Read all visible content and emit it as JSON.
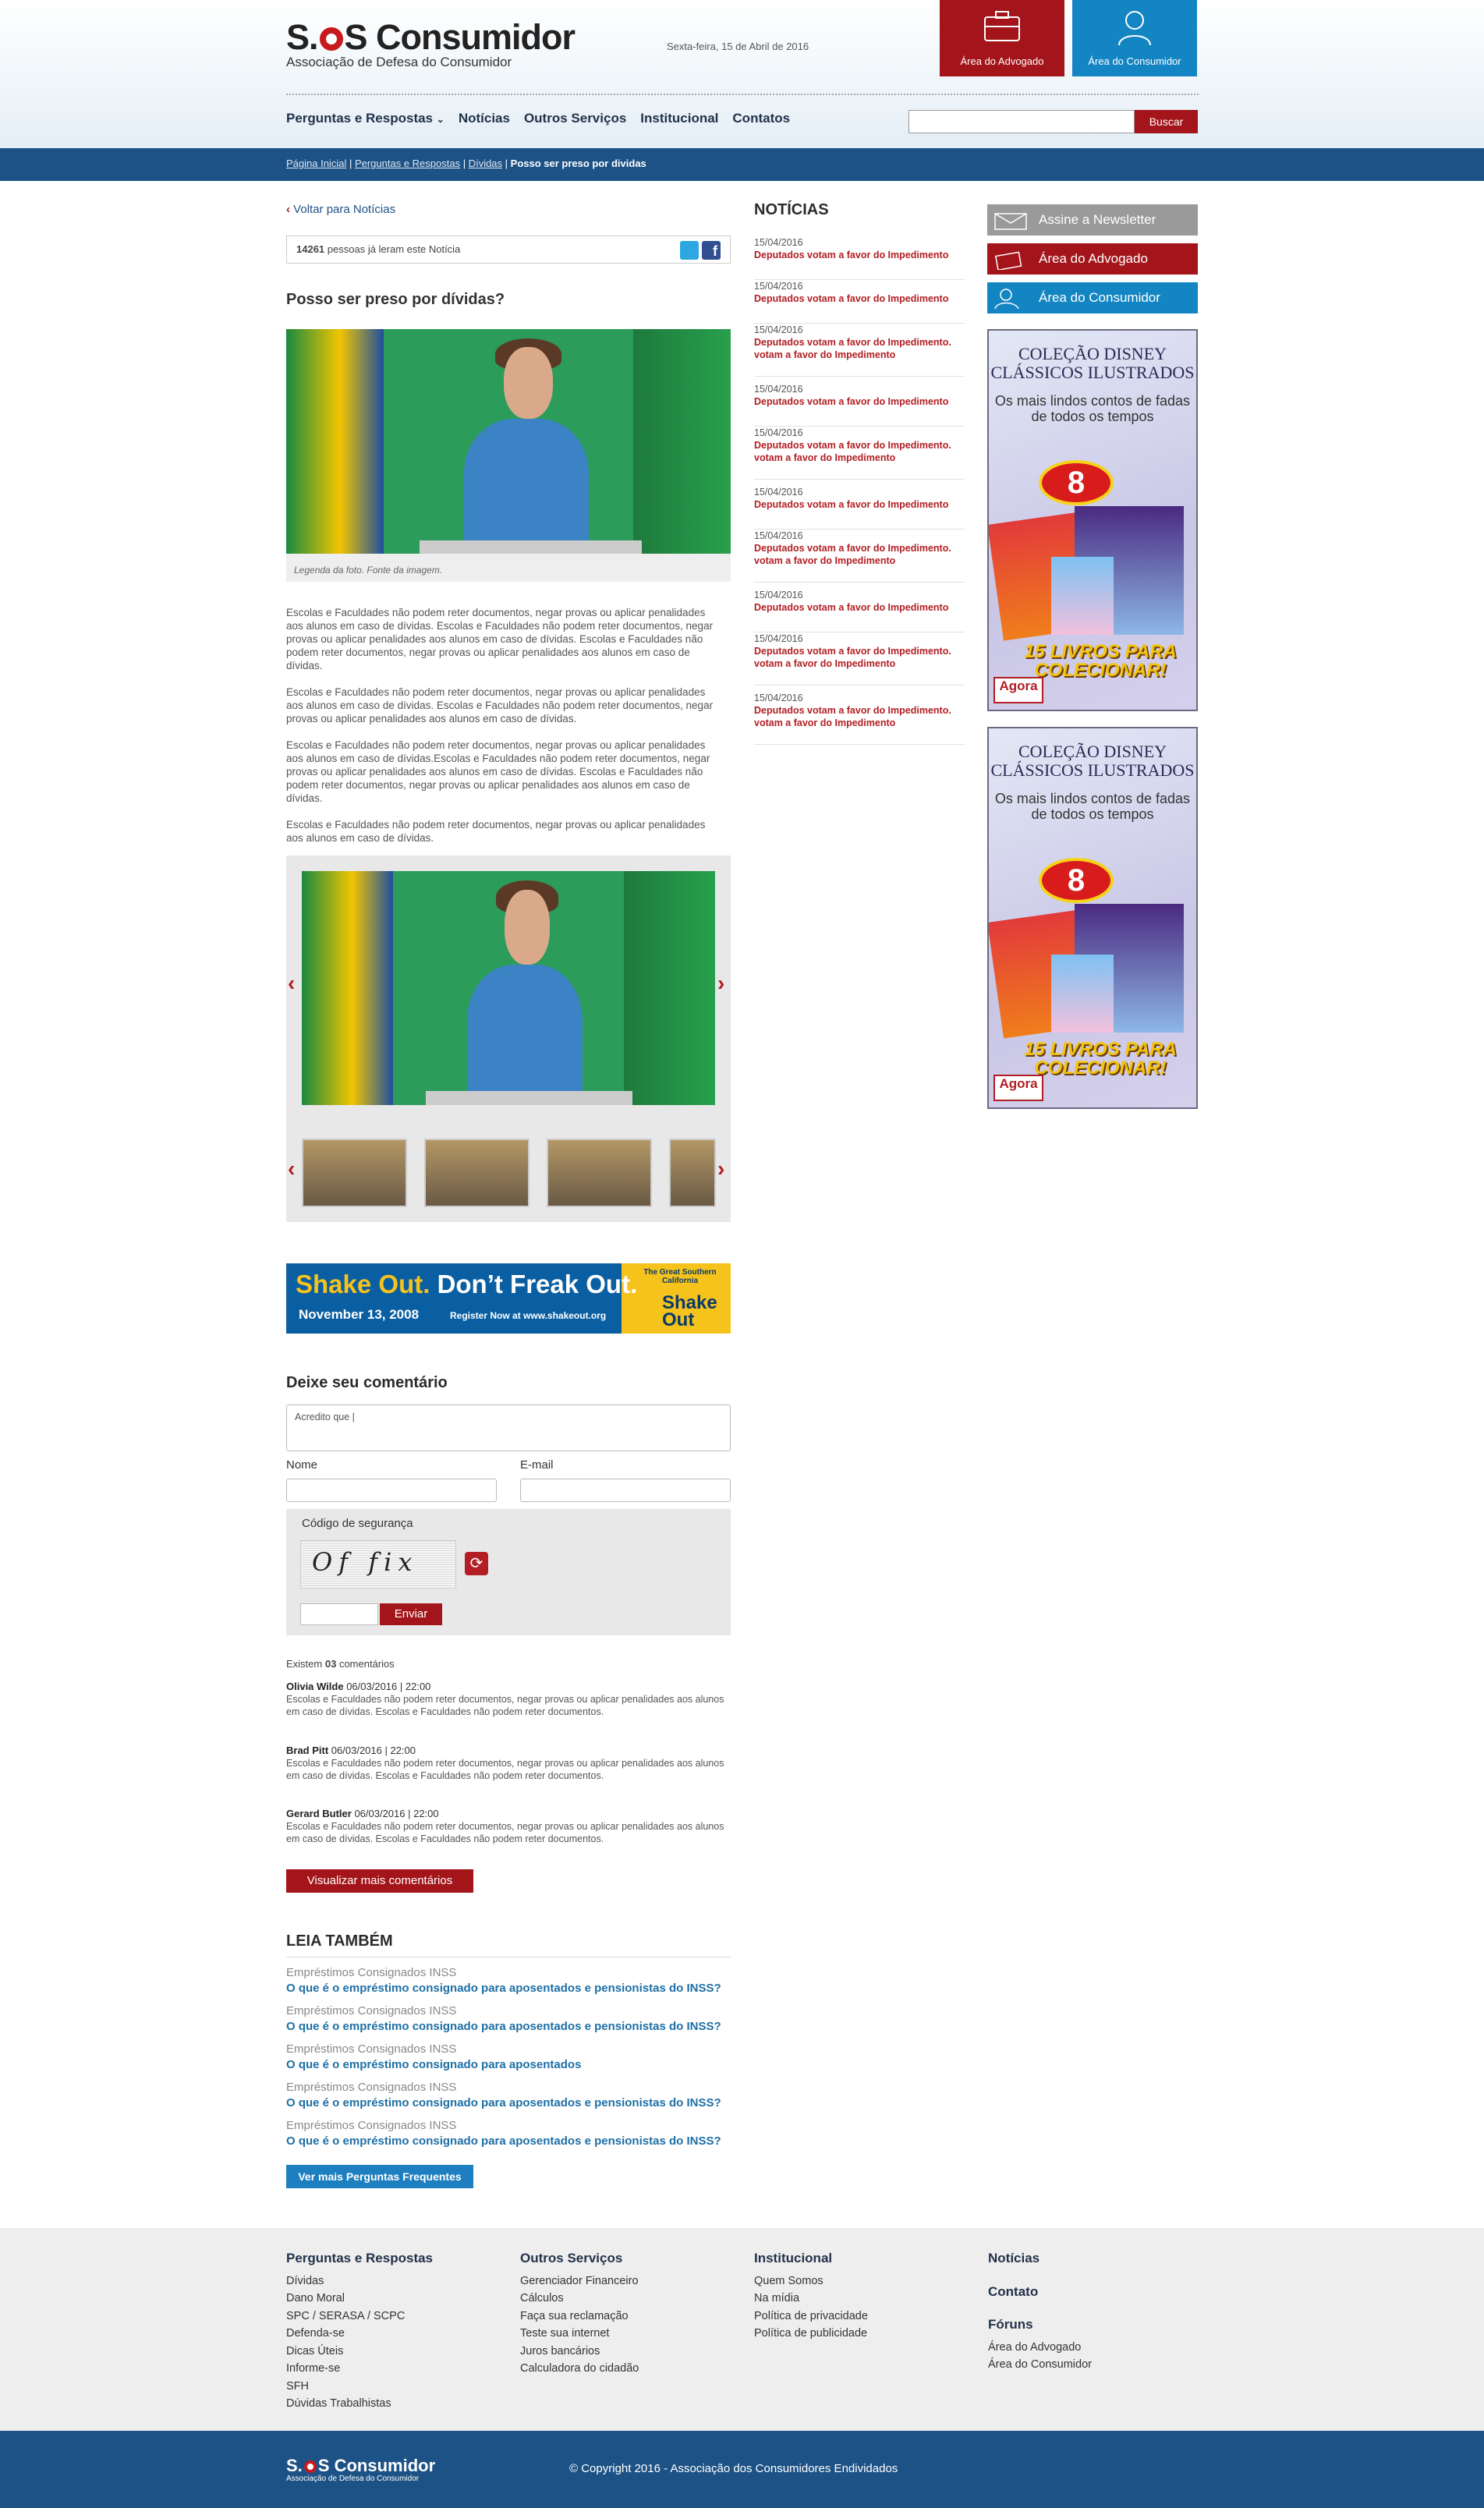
{
  "header": {
    "logo_title_left": "S.",
    "logo_title_right": "S Consumidor",
    "logo_subtitle": "Associação de Defesa do Consumidor",
    "date": "Sexta-feira, 15 de Abril de 2016",
    "btn_advogado": "Área do Advogado",
    "btn_consumidor": "Área do Consumidor",
    "accent_red": "#a3151a",
    "accent_blue": "#1485c3"
  },
  "nav": {
    "items": [
      "Perguntas e Respostas",
      "Notícias",
      "Outros Serviços",
      "Institucional",
      "Contatos"
    ],
    "search_button": "Buscar",
    "search_placeholder": ""
  },
  "breadcrumb": {
    "items": [
      "Página Inicial",
      "Perguntas e Respostas",
      "Dívidas"
    ],
    "current": "Posso ser preso por dividas"
  },
  "article": {
    "back_link": "Voltar para Notícias",
    "read_count": "14261",
    "read_text": "pessoas já leram este Notícia",
    "title": "Posso ser preso por dívidas?",
    "photo_caption": "Legenda da foto. Fonte da imagem.",
    "paragraphs": [
      "Escolas e Faculdades não podem reter documentos, negar provas ou aplicar penalidades aos alunos em caso de dívidas. Escolas e Faculdades não podem reter documentos, negar provas ou aplicar penalidades aos alunos em caso de dívidas. Escolas e Faculdades não podem reter documentos, negar provas ou aplicar penalidades aos alunos em caso de dívidas.",
      "Escolas e Faculdades não podem reter documentos, negar provas ou aplicar penalidades aos alunos em caso de dívidas. Escolas e Faculdades não podem reter documentos, negar provas ou aplicar penalidades aos alunos em caso de dívidas.",
      "Escolas e Faculdades não podem reter documentos, negar provas ou aplicar penalidades aos alunos em caso de dívidas.Escolas e Faculdades não podem reter documentos, negar provas ou aplicar penalidades aos alunos em caso de dívidas. Escolas e Faculdades não podem reter documentos, negar provas ou aplicar penalidades aos alunos em caso de dívidas.",
      "Escolas e Faculdades não podem reter documentos, negar provas ou aplicar penalidades aos alunos em caso de dívidas."
    ]
  },
  "ad_banner": {
    "line1_yellow": "Shake Out.",
    "line1_white": "Don’t Freak Out.",
    "date": "November 13, 2008",
    "register": "Register Now at www.shakeout.org",
    "badge_top": "The Great Southern California",
    "badge_main": "Shake Out"
  },
  "comment_form": {
    "heading": "Deixe seu comentário",
    "textarea_value": "Acredito que |",
    "name_label": "Nome",
    "email_label": "E-mail",
    "security_label": "Código de segurança",
    "captcha_text": "Of fix",
    "submit": "Enviar"
  },
  "comments": {
    "count_prefix": "Existem",
    "count": "03",
    "count_suffix": "comentários",
    "items": [
      {
        "author": "Olivia Wilde",
        "date": "06/03/2016 | 22:00",
        "text": "Escolas e Faculdades não podem reter documentos, negar provas ou aplicar penalidades aos alunos em caso de dívidas. Escolas e Faculdades não podem reter documentos."
      },
      {
        "author": "Brad Pitt",
        "date": "06/03/2016 | 22:00",
        "text": "Escolas e Faculdades não podem reter documentos, negar provas ou aplicar penalidades aos alunos em caso de dívidas. Escolas e Faculdades não podem reter documentos."
      },
      {
        "author": "Gerard Butler",
        "date": "06/03/2016 | 22:00",
        "text": "Escolas e Faculdades não podem reter documentos, negar provas ou aplicar penalidades aos alunos em caso de dívidas. Escolas e Faculdades não podem reter documentos."
      }
    ],
    "more_button": "Visualizar mais comentários"
  },
  "leia_tambem": {
    "heading": "LEIA TAMBÉM",
    "items": [
      {
        "cat": "Empréstimos Consignados INSS",
        "q": "O que é o empréstimo consignado para aposentados e pensionistas do INSS?"
      },
      {
        "cat": "Empréstimos Consignados INSS",
        "q": "O que é o empréstimo consignado para aposentados e pensionistas do INSS?"
      },
      {
        "cat": "Empréstimos Consignados INSS",
        "q": "O que é o empréstimo consignado para aposentados"
      },
      {
        "cat": "Empréstimos Consignados INSS",
        "q": "O que é o empréstimo consignado para aposentados e pensionistas do INSS?"
      },
      {
        "cat": "Empréstimos Consignados INSS",
        "q": "O que é o empréstimo consignado para aposentados e pensionistas do INSS?"
      }
    ],
    "more_button": "Ver mais Perguntas Frequentes"
  },
  "news": {
    "heading": "NOTÍCIAS",
    "items": [
      {
        "date": "15/04/2016",
        "title": "Deputados votam a favor do Impedimento"
      },
      {
        "date": "15/04/2016",
        "title": "Deputados votam a favor do Impedimento"
      },
      {
        "date": "15/04/2016",
        "title": "Deputados votam a favor do Impedimento. votam a favor do Impedimento"
      },
      {
        "date": "15/04/2016",
        "title": "Deputados votam a favor do Impedimento"
      },
      {
        "date": "15/04/2016",
        "title": "Deputados votam a favor do Impedimento. votam a favor do Impedimento"
      },
      {
        "date": "15/04/2016",
        "title": "Deputados votam a favor do Impedimento"
      },
      {
        "date": "15/04/2016",
        "title": "Deputados votam a favor do Impedimento. votam a favor do Impedimento"
      },
      {
        "date": "15/04/2016",
        "title": "Deputados votam a favor do Impedimento"
      },
      {
        "date": "15/04/2016",
        "title": "Deputados votam a favor do Impedimento. votam a favor do Impedimento"
      },
      {
        "date": "15/04/2016",
        "title": "Deputados votam a favor do Impedimento. votam a favor do Impedimento"
      }
    ]
  },
  "sidebar": {
    "newsletter": "Assine a Newsletter",
    "advogado": "Área do Advogado",
    "consumidor": "Área do Consumidor",
    "ad_title": "COLEÇÃO DISNEY CLÁSSICOS ILUSTRADOS",
    "ad_sub": "Os mais lindos contos de fadas de todos os tempos",
    "ad_price": "8",
    "ad_promo": "15 LIVROS PARA COLECIONAR!",
    "ad_brand": "Agora"
  },
  "footer": {
    "col1": {
      "title": "Perguntas e Respostas",
      "items": [
        "Dívidas",
        "Dano Moral",
        "SPC / SERASA / SCPC",
        "Defenda-se",
        "Dicas Úteis",
        "Informe-se",
        "SFH",
        "Dúvidas Trabalhistas"
      ]
    },
    "col2": {
      "title": "Outros Serviços",
      "items": [
        "Gerenciador Financeiro",
        "Cálculos",
        "Faça sua reclamação",
        "Teste sua internet",
        "Juros bancários",
        "Calculadora do cidadão"
      ]
    },
    "col3": {
      "title": "Institucional",
      "items": [
        "Quem Somos",
        "Na mídia",
        "Política de privacidade",
        "Política de publicidade"
      ]
    },
    "col4": {
      "noticias": "Notícias",
      "contato": "Contato",
      "foruns": "Fóruns",
      "items": [
        "Área do Advogado",
        "Área do Consumidor"
      ]
    },
    "bottom_logo_left": "S.",
    "bottom_logo_right": "S Consumidor",
    "bottom_logo_sub": "Associação de Defesa do Consumidor",
    "copyright": "© Copyright 2016 - Associação dos Consumidores Endividados"
  }
}
